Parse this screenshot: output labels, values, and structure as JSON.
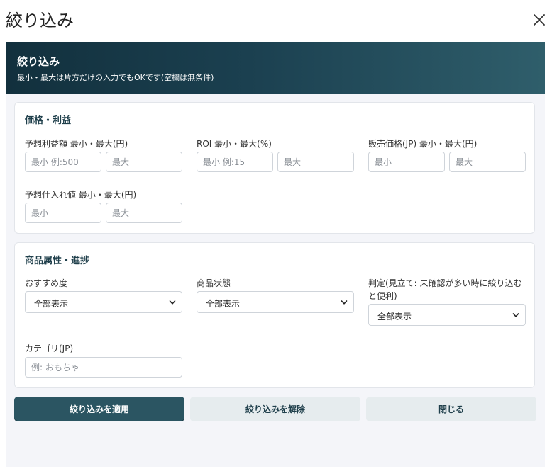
{
  "dialog": {
    "title": "絞り込み"
  },
  "banner": {
    "title": "絞り込み",
    "subtitle": "最小・最大は片方だけの入力でもOKです(空欄は無条件)"
  },
  "price_section": {
    "title": "価格・利益",
    "fields": [
      {
        "label": "予想利益額 最小・最大(円)",
        "min_placeholder": "最小 例:500",
        "max_placeholder": "最大"
      },
      {
        "label": "ROI 最小・最大(%)",
        "min_placeholder": "最小 例:15",
        "max_placeholder": "最大"
      },
      {
        "label": "販売価格(JP) 最小・最大(円)",
        "min_placeholder": "最小",
        "max_placeholder": "最大"
      },
      {
        "label": "予想仕入れ値 最小・最大(円)",
        "min_placeholder": "最小",
        "max_placeholder": "最大"
      }
    ]
  },
  "attr_section": {
    "title": "商品属性・進捗",
    "selects": [
      {
        "label": "おすすめ度",
        "value": "全部表示"
      },
      {
        "label": "商品状態",
        "value": "全部表示"
      },
      {
        "label_line1": "判定(見立て: 未確認が多い時に絞り込む",
        "label_line2": "と便利)",
        "value": "全部表示"
      }
    ],
    "category": {
      "label": "カテゴリ(JP)",
      "placeholder": "例: おもちゃ"
    }
  },
  "buttons": {
    "apply": "絞り込みを適用",
    "clear": "絞り込みを解除",
    "close": "閉じる"
  },
  "colors": {
    "primary": "#2b5562",
    "secondary": "#e6ecee",
    "banner_dark": "#12303d",
    "banner_light": "#2f5e6b"
  }
}
